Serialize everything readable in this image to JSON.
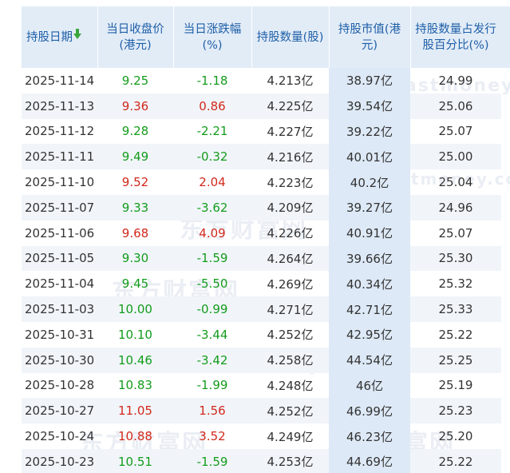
{
  "table": {
    "headers": [
      {
        "label": "持股日期",
        "sortable": true
      },
      {
        "label": "当日收盘价(港元)"
      },
      {
        "label": "当日涨跌幅(%)"
      },
      {
        "label": "持股数量(股)"
      },
      {
        "label": "持股市值(港元)"
      },
      {
        "label": "持股数量占发行股百分比(%)"
      }
    ],
    "rows": [
      {
        "date": "2025-11-14",
        "close": "9.25",
        "change": "-1.18",
        "dir": "down",
        "shares": "4.213亿",
        "value": "38.97亿",
        "pct": "24.99"
      },
      {
        "date": "2025-11-13",
        "close": "9.36",
        "change": "0.86",
        "dir": "up",
        "shares": "4.225亿",
        "value": "39.54亿",
        "pct": "25.06"
      },
      {
        "date": "2025-11-12",
        "close": "9.28",
        "change": "-2.21",
        "dir": "down",
        "shares": "4.227亿",
        "value": "39.22亿",
        "pct": "25.07"
      },
      {
        "date": "2025-11-11",
        "close": "9.49",
        "change": "-0.32",
        "dir": "down",
        "shares": "4.216亿",
        "value": "40.01亿",
        "pct": "25.00"
      },
      {
        "date": "2025-11-10",
        "close": "9.52",
        "change": "2.04",
        "dir": "up",
        "shares": "4.223亿",
        "value": "40.2亿",
        "pct": "25.04"
      },
      {
        "date": "2025-11-07",
        "close": "9.33",
        "change": "-3.62",
        "dir": "down",
        "shares": "4.209亿",
        "value": "39.27亿",
        "pct": "24.96"
      },
      {
        "date": "2025-11-06",
        "close": "9.68",
        "change": "4.09",
        "dir": "up",
        "shares": "4.226亿",
        "value": "40.91亿",
        "pct": "25.07"
      },
      {
        "date": "2025-11-05",
        "close": "9.30",
        "change": "-1.59",
        "dir": "down",
        "shares": "4.264亿",
        "value": "39.66亿",
        "pct": "25.30"
      },
      {
        "date": "2025-11-04",
        "close": "9.45",
        "change": "-5.50",
        "dir": "down",
        "shares": "4.269亿",
        "value": "40.34亿",
        "pct": "25.32"
      },
      {
        "date": "2025-11-03",
        "close": "10.00",
        "change": "-0.99",
        "dir": "down",
        "shares": "4.271亿",
        "value": "42.71亿",
        "pct": "25.33"
      },
      {
        "date": "2025-10-31",
        "close": "10.10",
        "change": "-3.44",
        "dir": "down",
        "shares": "4.252亿",
        "value": "42.95亿",
        "pct": "25.22"
      },
      {
        "date": "2025-10-30",
        "close": "10.46",
        "change": "-3.42",
        "dir": "down",
        "shares": "4.258亿",
        "value": "44.54亿",
        "pct": "25.25"
      },
      {
        "date": "2025-10-28",
        "close": "10.83",
        "change": "-1.99",
        "dir": "down",
        "shares": "4.248亿",
        "value": "46亿",
        "pct": "25.19"
      },
      {
        "date": "2025-10-27",
        "close": "11.05",
        "change": "1.56",
        "dir": "up",
        "shares": "4.252亿",
        "value": "46.99亿",
        "pct": "25.23"
      },
      {
        "date": "2025-10-24",
        "close": "10.88",
        "change": "3.52",
        "dir": "up",
        "shares": "4.249亿",
        "value": "46.23亿",
        "pct": "25.20"
      },
      {
        "date": "2025-10-23",
        "close": "10.51",
        "change": "-1.59",
        "dir": "down",
        "shares": "4.253亿",
        "value": "44.69亿",
        "pct": "25.22"
      }
    ]
  },
  "watermark": {
    "brand_cn": "东方财富网",
    "brand_en": "eastmoney.com"
  },
  "colors": {
    "header_bg": "#e2ecf7",
    "header_text": "#1f5fa8",
    "up": "#d2281c",
    "down": "#149c1c",
    "sort_arrow": "#39a63a",
    "stripe": "#f1f5fa",
    "market_value_col": "#dde9f6"
  }
}
